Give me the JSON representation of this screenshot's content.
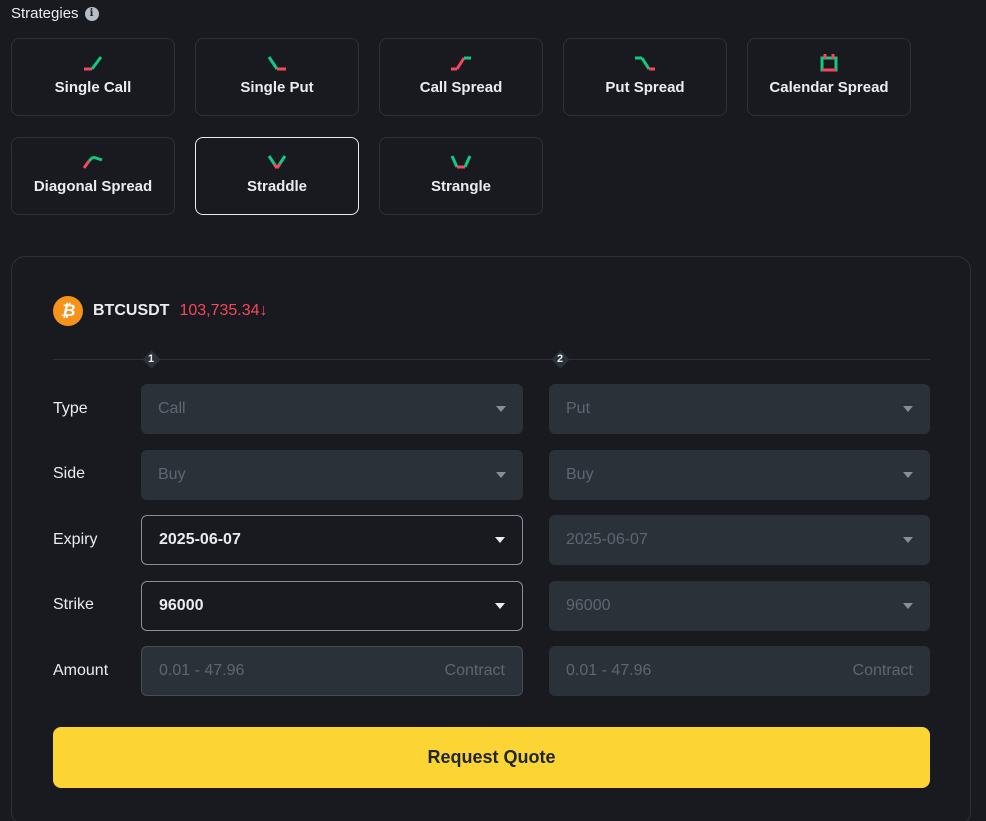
{
  "strategies": {
    "title": "Strategies",
    "info_icon": "i",
    "items": [
      {
        "label": "Single Call",
        "icon": "single-call-icon"
      },
      {
        "label": "Single Put",
        "icon": "single-put-icon"
      },
      {
        "label": "Call Spread",
        "icon": "call-spread-icon"
      },
      {
        "label": "Put Spread",
        "icon": "put-spread-icon"
      },
      {
        "label": "Calendar Spread",
        "icon": "calendar-spread-icon"
      },
      {
        "label": "Diagonal Spread",
        "icon": "diagonal-spread-icon"
      },
      {
        "label": "Straddle",
        "icon": "straddle-icon",
        "selected": true
      },
      {
        "label": "Strangle",
        "icon": "strangle-icon"
      }
    ]
  },
  "pair": {
    "coin_glyph": "₿",
    "symbol": "BTCUSDT",
    "price": "103,735.34",
    "direction_glyph": "↓"
  },
  "legs": [
    "1",
    "2"
  ],
  "form": {
    "labels": {
      "type": "Type",
      "side": "Side",
      "expiry": "Expiry",
      "strike": "Strike",
      "amount": "Amount"
    },
    "leg1": {
      "type": "Call",
      "side": "Buy",
      "expiry": "2025-06-07",
      "strike": "96000",
      "amount_placeholder": "0.01 - 47.96",
      "amount_unit": "Contract"
    },
    "leg2": {
      "type": "Put",
      "side": "Buy",
      "expiry": "2025-06-07",
      "strike": "96000",
      "amount_placeholder": "0.01 - 47.96",
      "amount_unit": "Contract"
    }
  },
  "request_button": "Request Quote",
  "colors": {
    "up": "#0ecb81",
    "down": "#f6465d",
    "accent": "#fcd535",
    "bitcoin": "#f7931a"
  }
}
